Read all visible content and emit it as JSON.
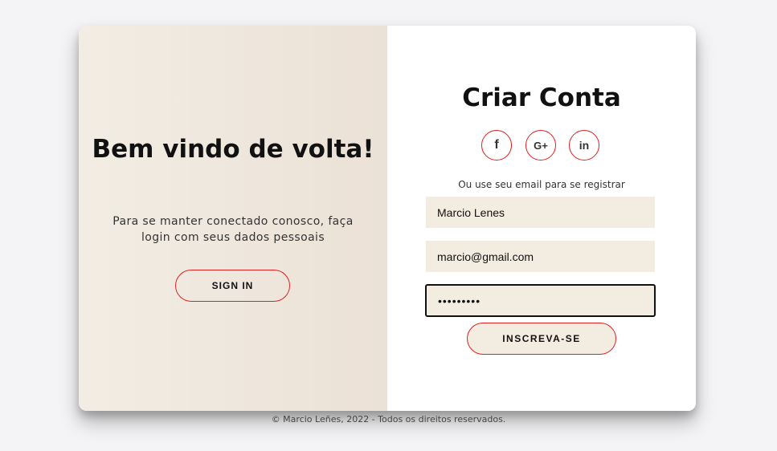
{
  "colors": {
    "page_background": "#f4f4f6",
    "accent_border": "#e02020",
    "left_gradient_start": "#f2ede4",
    "left_gradient_end": "#ebe1d6",
    "field_background": "#f2ece1"
  },
  "left": {
    "title": "Bem vindo de volta!",
    "text": "Para se manter conectado conosco, faça login com seus dados pessoais",
    "sign_in_label": "SIGN IN"
  },
  "right": {
    "title": "Criar Conta",
    "social": [
      {
        "icon": "facebook-icon",
        "glyph": "f"
      },
      {
        "icon": "google-plus-icon",
        "glyph": "G+"
      },
      {
        "icon": "linkedin-icon",
        "glyph": "in"
      }
    ],
    "hint": "Ou use seu email para se registrar",
    "fields": {
      "name_value": "Marcio Lenes",
      "email_value": "marcio@gmail.com",
      "password_value": "•••••••••"
    },
    "submit_label": "INSCREVA-SE"
  },
  "footer": "© Marcio Leñes, 2022 - Todos os direitos reservados."
}
